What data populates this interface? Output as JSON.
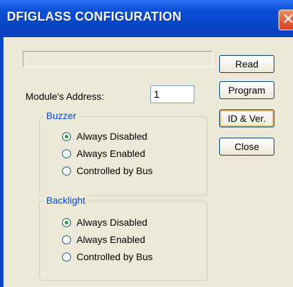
{
  "window": {
    "title": "DFIGLASS CONFIGURATION",
    "close_glyph": "✕"
  },
  "status": {
    "text": ""
  },
  "address": {
    "label": "Module's Address:",
    "value": "1"
  },
  "buzzer": {
    "legend": "Buzzer",
    "options": [
      {
        "label": "Always Disabled",
        "checked": true
      },
      {
        "label": "Always Enabled",
        "checked": false
      },
      {
        "label": "Controlled by Bus",
        "checked": false
      }
    ]
  },
  "backlight": {
    "legend": "Backlight",
    "options": [
      {
        "label": "Always Disabled",
        "checked": true
      },
      {
        "label": "Always Enabled",
        "checked": false
      },
      {
        "label": "Controlled by Bus",
        "checked": false
      }
    ]
  },
  "buttons": {
    "read": "Read",
    "program": "Program",
    "id_ver": "ID & Ver.",
    "close": "Close"
  },
  "colors": {
    "title_bar": "#0a45c8",
    "dialog_bg": "#ece9d8",
    "group_label": "#0046d5",
    "radio_dot": "#21a121",
    "close_button": "#d6411e"
  },
  "icons": {
    "close": "close-icon"
  }
}
